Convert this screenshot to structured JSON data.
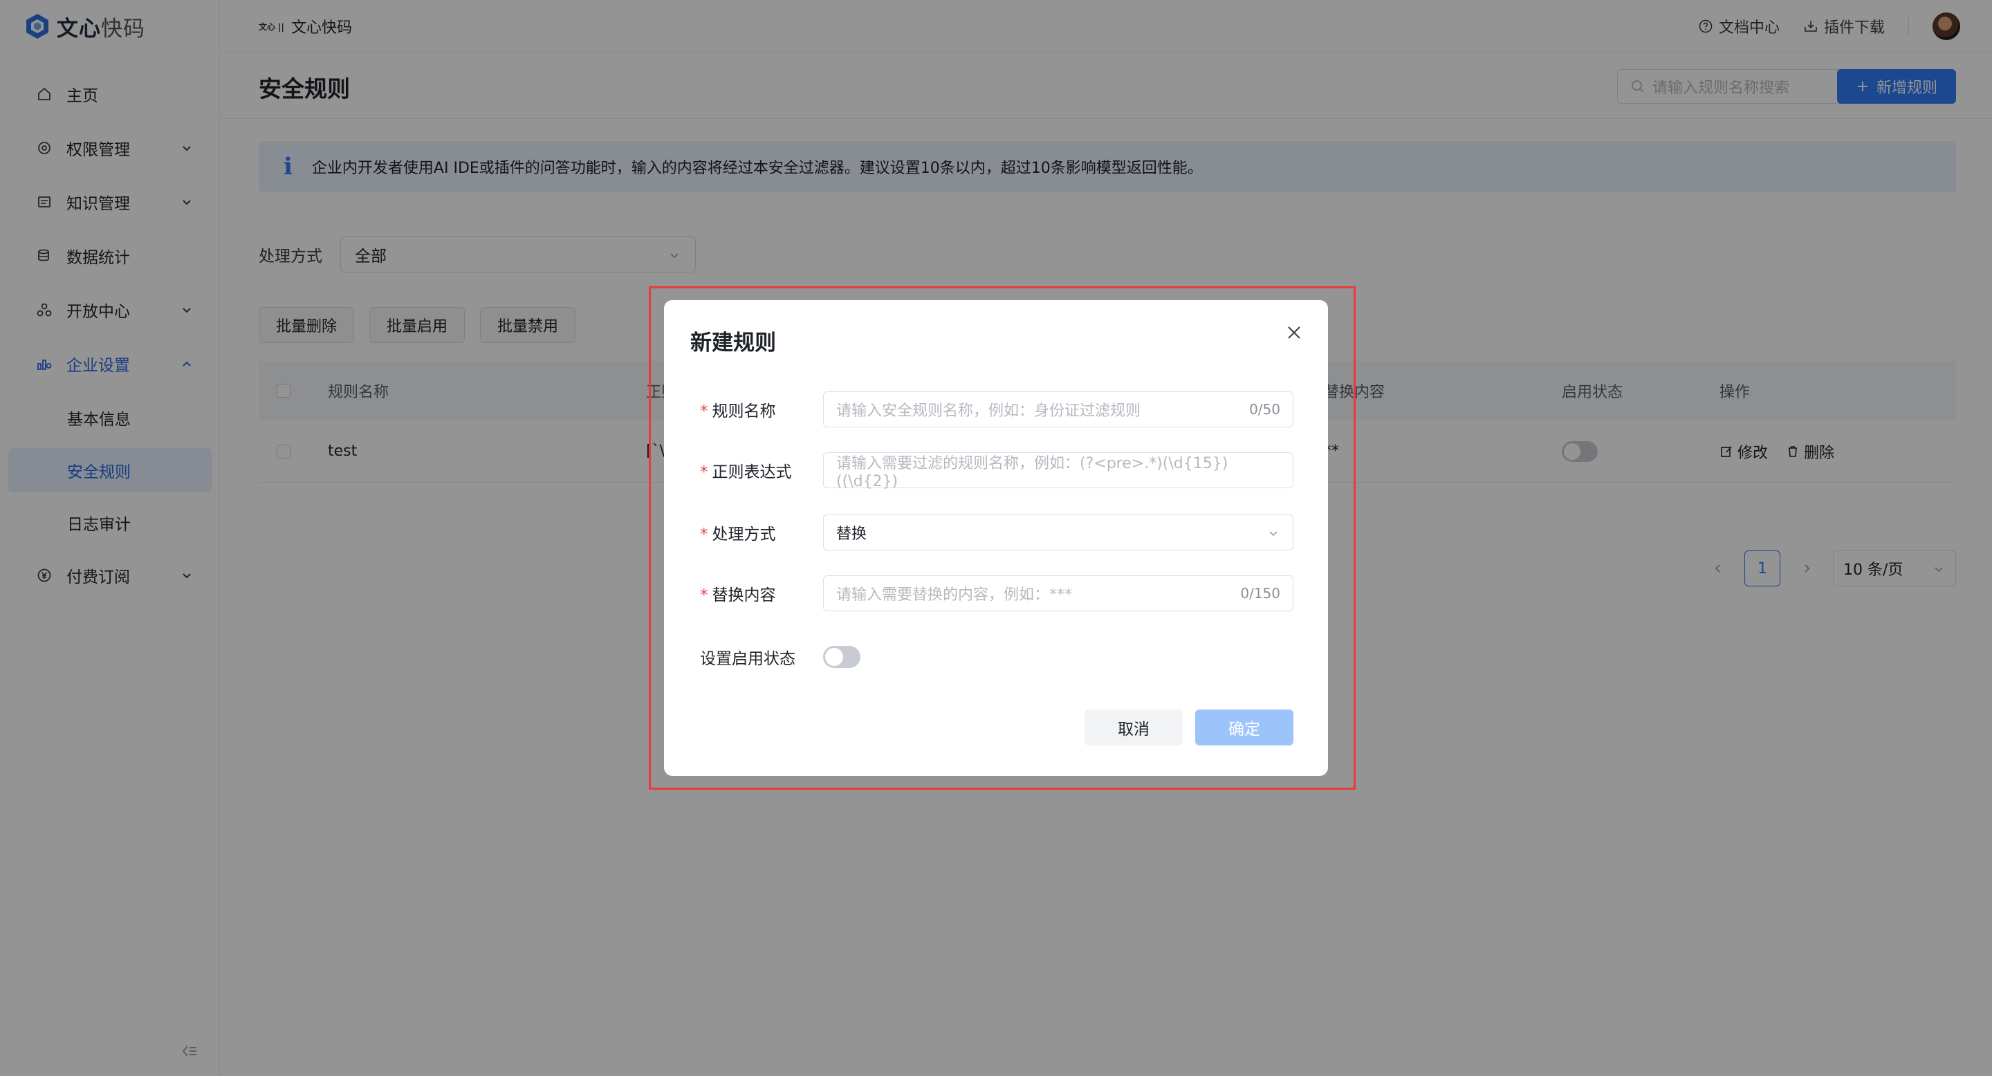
{
  "app": {
    "logo_main": "文心",
    "logo_light": "快码",
    "crumb_mini": "文心 ||",
    "crumb_title": "文心快码"
  },
  "top": {
    "docs": "文档中心",
    "plugin": "插件下载"
  },
  "sidebar": {
    "items": [
      {
        "label": "主页"
      },
      {
        "label": "权限管理"
      },
      {
        "label": "知识管理"
      },
      {
        "label": "数据统计"
      },
      {
        "label": "开放中心"
      },
      {
        "label": "企业设置"
      },
      {
        "label": "付费订阅"
      }
    ],
    "sub_items": [
      {
        "label": "基本信息"
      },
      {
        "label": "安全规则"
      },
      {
        "label": "日志审计"
      }
    ]
  },
  "page": {
    "title": "安全规则",
    "search_placeholder": "请输入规则名称搜索",
    "add_button": "新增规则",
    "notice": "企业内开发者使用AI IDE或插件的问答功能时，输入的内容将经过本安全过滤器。建议设置10条以内，超过10条影响模型返回性能。",
    "filter_label": "处理方式",
    "filter_value": "全部",
    "batch": [
      "批量删除",
      "批量启用",
      "批量禁用"
    ]
  },
  "table": {
    "headers": {
      "name": "规则名称",
      "regex": "正则",
      "replace": "替换内容",
      "status": "启用状态",
      "ops": "操作"
    },
    "rows": [
      {
        "name": "test",
        "regex": "[`\\",
        "replace": "**",
        "edit": "修改",
        "delete": "删除"
      }
    ]
  },
  "pager": {
    "page": "1",
    "size": "10 条/页"
  },
  "modal": {
    "title": "新建规则",
    "name_label": "规则名称",
    "name_placeholder": "请输入安全规则名称，例如：身份证过滤规则",
    "name_count": "0/50",
    "regex_label": "正则表达式",
    "regex_placeholder": "请输入需要过滤的规则名称，例如：(?<pre>.*)(\\d{15})((\\d{2})",
    "mode_label": "处理方式",
    "mode_value": "替换",
    "replace_label": "替换内容",
    "replace_placeholder": "请输入需要替换的内容，例如：***",
    "replace_count": "0/150",
    "status_label": "设置启用状态",
    "cancel": "取消",
    "ok": "确定"
  },
  "colors": {
    "accent": "#2f7cf6",
    "highlight": "#ea3b3b",
    "required": "#e54545"
  }
}
